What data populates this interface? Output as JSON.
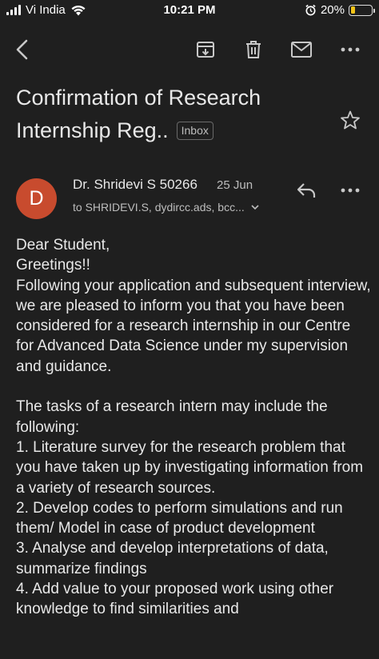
{
  "status_bar": {
    "carrier": "Vi India",
    "time": "10:21 PM",
    "battery_percent": "20%",
    "battery_level": 0.2,
    "battery_color": "#f5c518"
  },
  "toolbar": {
    "back_icon": "back-arrow-icon",
    "archive_icon": "archive-icon",
    "delete_icon": "trash-icon",
    "mark_unread_icon": "mail-icon",
    "more_icon": "more-dots-icon"
  },
  "email": {
    "subject_line1": "Confirmation of Research",
    "subject_line2": "Internship Reg..",
    "label": "Inbox",
    "sender_initial": "D",
    "avatar_color": "#c84b2e",
    "sender_name": "Dr. Shridevi S 50266",
    "date": "25 Jun",
    "recipients": "to SHRIDEVI.S, dydircc.ads, bcc...",
    "body": {
      "greeting": "Dear Student,",
      "greetings": "Greetings!!",
      "intro": "Following your application and subsequent interview, we are pleased to inform you that you have been considered for a research internship in our Centre for Advanced Data Science under my supervision and guidance.",
      "tasks_heading": "The tasks of a research intern may include the following:",
      "tasks": [
        "1. Literature survey for the research problem that you have taken up by investigating information from a variety of research sources.",
        "2. Develop codes to perform simulations and run them/ Model in case of product development",
        "3. Analyse and develop interpretations of data, summarize findings",
        "4. Add value to your proposed work using other knowledge to find similarities and"
      ]
    }
  }
}
